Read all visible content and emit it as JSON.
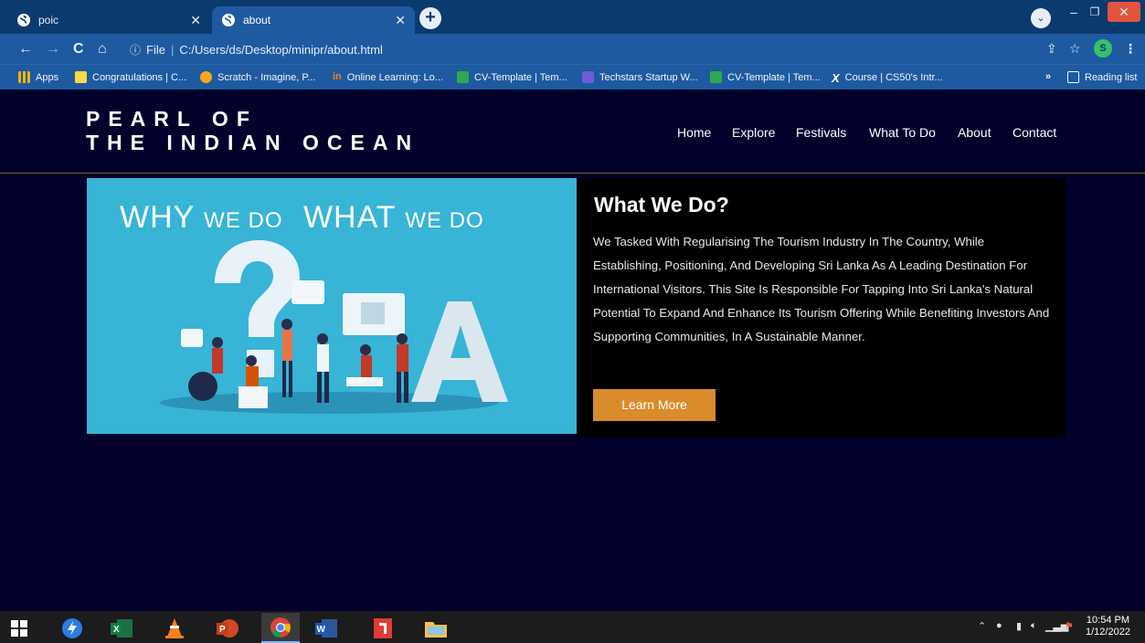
{
  "browser": {
    "tabs": [
      {
        "title": "poic",
        "active": false
      },
      {
        "title": "about",
        "active": true
      }
    ],
    "address": {
      "scheme_label": "File",
      "path": "C:/Users/ds/Desktop/minipr/about.html"
    },
    "profile_initial": "S",
    "bookmarks": [
      {
        "label": "Apps",
        "icon": "apps-grid-icon",
        "color": "#f4b400"
      },
      {
        "label": "Congratulations | C...",
        "icon": "grid-icon",
        "color": "#f9d849"
      },
      {
        "label": "Scratch - Imagine, P...",
        "icon": "scratch-icon",
        "color": "#f8a71b"
      },
      {
        "label": "Online Learning: Lo...",
        "icon": "online-learning-icon",
        "color": "#ff7a1a"
      },
      {
        "label": "CV-Template | Tem...",
        "icon": "cv-icon",
        "color": "#2fa84f"
      },
      {
        "label": "Techstars Startup W...",
        "icon": "list-icon",
        "color": "#6f5bd6"
      },
      {
        "label": "CV-Template | Tem...",
        "icon": "cv-icon",
        "color": "#2fa84f"
      },
      {
        "label": "Course | CS50's Intr...",
        "icon": "edx-icon",
        "color": "#111111"
      }
    ],
    "bookmarks_overflow": "»",
    "reading_list": "Reading list"
  },
  "site": {
    "logo_line1": "PEARL OF",
    "logo_line2": "THE INDIAN OCEAN",
    "nav": [
      "Home",
      "Explore",
      "Festivals",
      "What To Do",
      "About",
      "Contact"
    ]
  },
  "hero": {
    "image_heading_big1": "WHY",
    "image_heading_small1": "WE DO",
    "image_heading_big2": "WHAT",
    "image_heading_small2": "WE DO",
    "image_color": "#38b4d7"
  },
  "content": {
    "title": "What We Do?",
    "body": "We Tasked With Regularising The Tourism Industry In The Country, While Establishing, Positioning, And Developing Sri Lanka As A Leading Destination For International Visitors. This Site Is Responsible For Tapping Into Sri Lanka's Natural Potential To Expand And Enhance Its Tourism Offering While Benefiting Investors And Supporting Communities, In A Sustainable Manner.",
    "button": "Learn More",
    "accent": "#d98c2b"
  },
  "taskbar": {
    "time": "10:54 PM",
    "date": "1/12/2022"
  }
}
